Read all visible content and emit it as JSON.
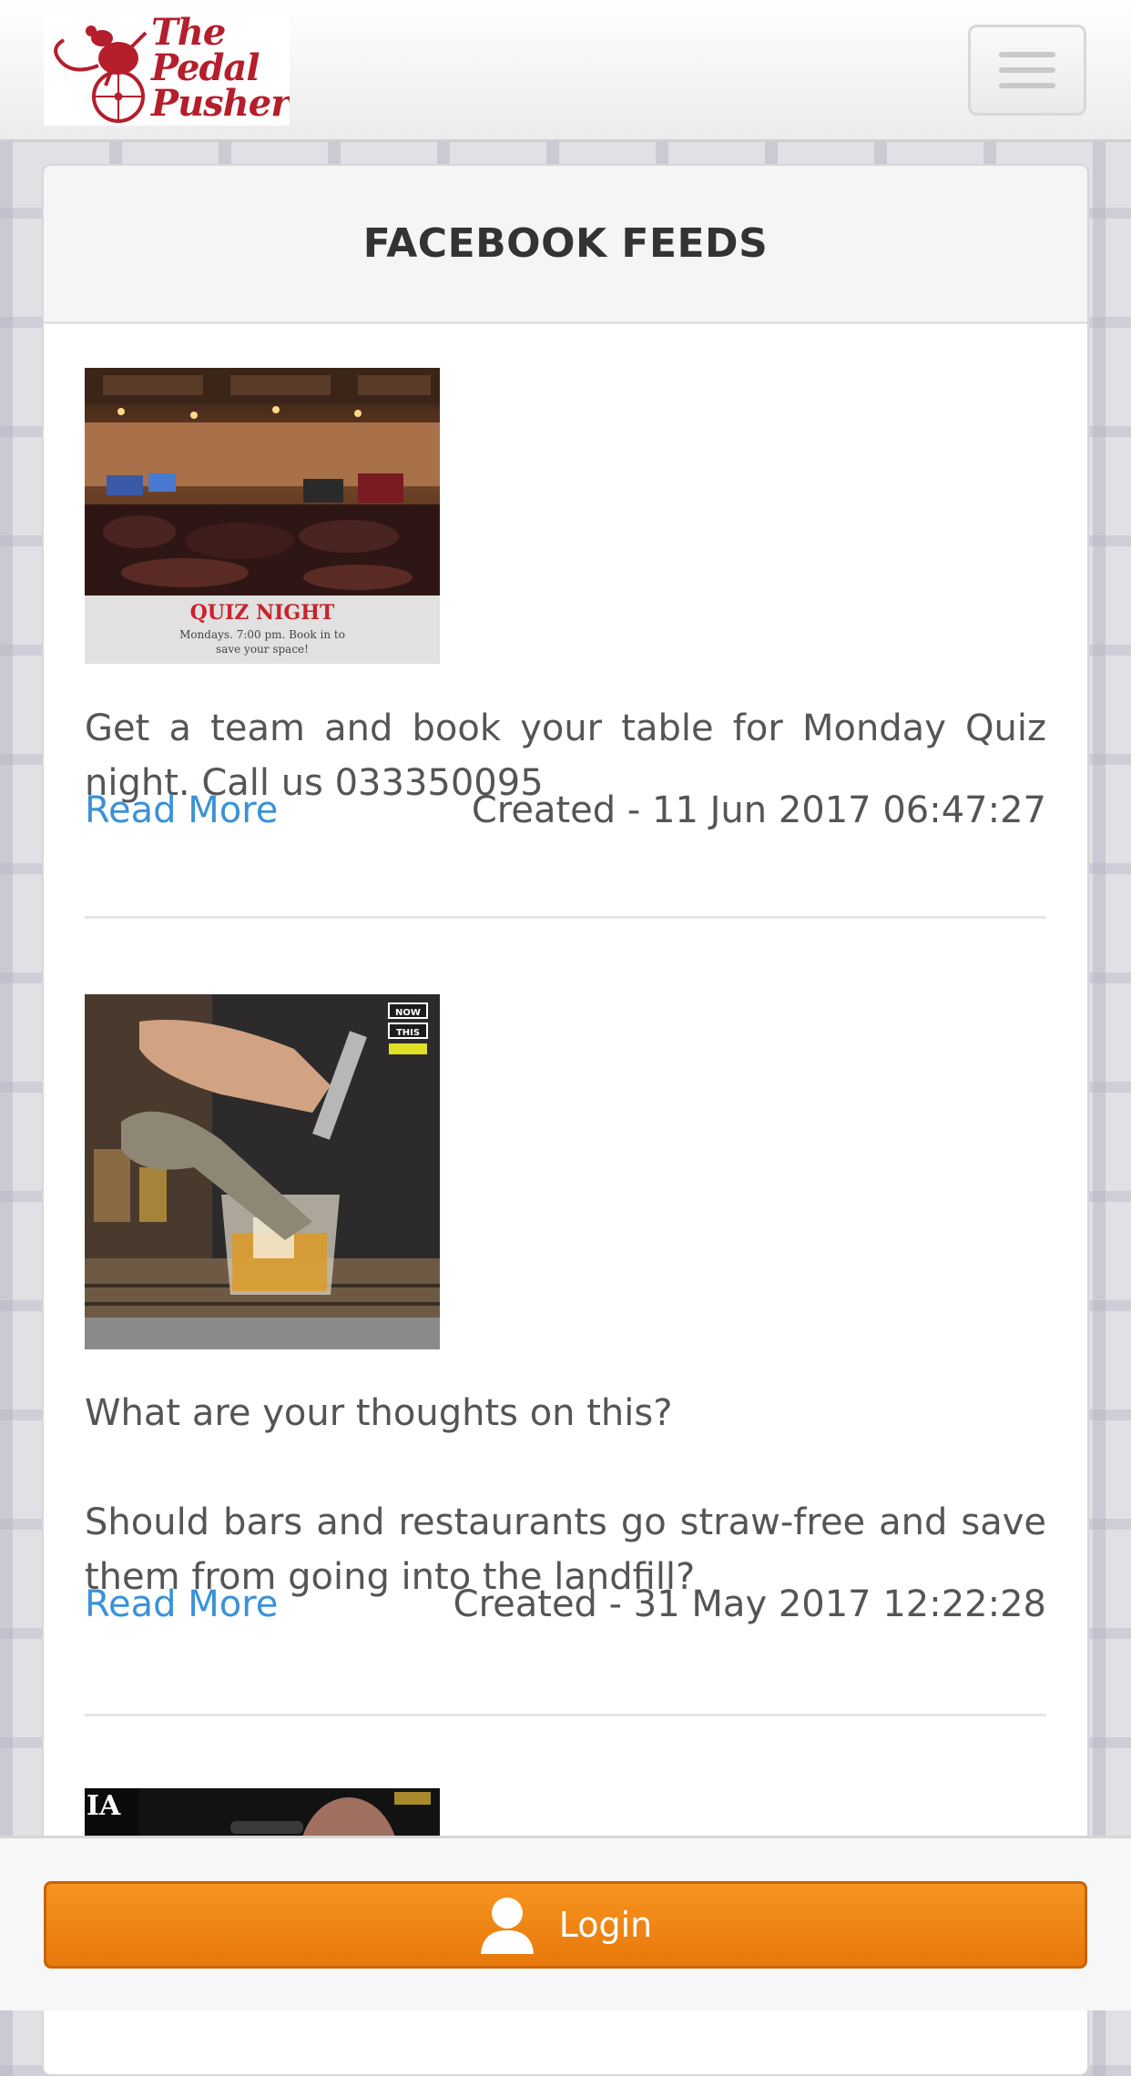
{
  "header": {
    "logo_text": "The Pedal Pusher",
    "menu_icon": "hamburger-menu-icon"
  },
  "section": {
    "title": "FACEBOOK FEEDS"
  },
  "posts": [
    {
      "image_caption_title": "QUIZ NIGHT",
      "image_caption_text": "Mondays. 7:00 pm. Book in to save your space!",
      "text": "Get a team and book your table for Monday Quiz night. Call us 033350095",
      "read_more": "Read More",
      "created": "Created - 11 Jun 2017 06:47:27"
    },
    {
      "image_badge": [
        "NOW",
        "THIS"
      ],
      "text_lines": [
        "What are your thoughts on this?",
        "Should bars and restaurants go straw-free and save them from going into the landfill?"
      ],
      "read_more": "Read More",
      "created": "Created - 31 May 2017 12:22:28"
    },
    {
      "image_overlay_text": "IA"
    }
  ],
  "footer": {
    "login_label": "Login",
    "login_icon": "user-icon"
  },
  "colors": {
    "accent_orange": "#f7941f",
    "link_blue": "#3a92d8",
    "brand_red": "#b51e2b",
    "text_gray": "#555555"
  }
}
